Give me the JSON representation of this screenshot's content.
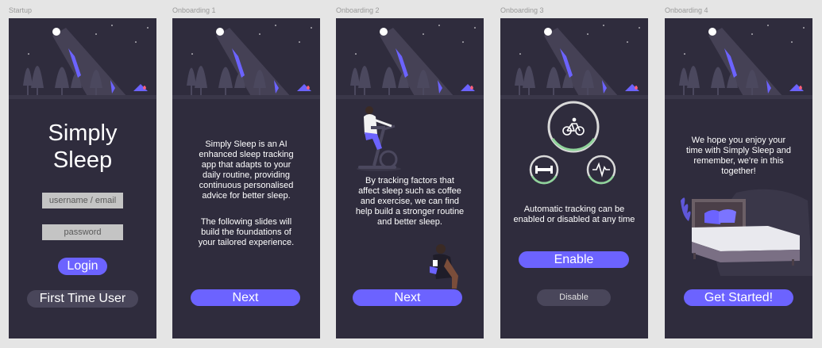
{
  "frames": {
    "startup": {
      "label": "Startup",
      "title_line1": "Simply",
      "title_line2": "Sleep",
      "username_placeholder": "username / email",
      "password_placeholder": "password",
      "login_label": "Login",
      "first_time_label": "First Time User"
    },
    "onboarding1": {
      "label": "Onboarding 1",
      "para1": [
        "Simply Sleep is an AI",
        "enhanced sleep tracking",
        "app that adapts to your",
        "daily routine, providing",
        "continuous personalised",
        "advice for better sleep."
      ],
      "para2": [
        "The following slides will",
        "build the foundations of",
        "your tailored experience."
      ],
      "next_label": "Next"
    },
    "onboarding2": {
      "label": "Onboarding 2",
      "para": [
        "By tracking factors that",
        "affect sleep such as coffee",
        "and exercise, we can find",
        "help build a stronger routine",
        "and better sleep."
      ],
      "next_label": "Next"
    },
    "onboarding3": {
      "label": "Onboarding 3",
      "para": [
        "Automatic tracking can be",
        "enabled or disabled at any time"
      ],
      "enable_label": "Enable",
      "disable_label": "Disable"
    },
    "onboarding4": {
      "label": "Onboarding 4",
      "para": [
        "We hope you enjoy your",
        "time with Simply Sleep and",
        "remember, we're in this",
        "together!"
      ],
      "get_started_label": "Get Started!"
    }
  },
  "colors": {
    "background": "#e5e5e5",
    "frame": "#2f2c3d",
    "accent": "#6c63ff",
    "dark_button": "#49465a",
    "input": "#c4c4c4",
    "ring_green": "#8fd39a"
  },
  "icons": [
    "moon-icon",
    "bicycle-icon",
    "dumbbell-icon",
    "heartbeat-icon"
  ]
}
